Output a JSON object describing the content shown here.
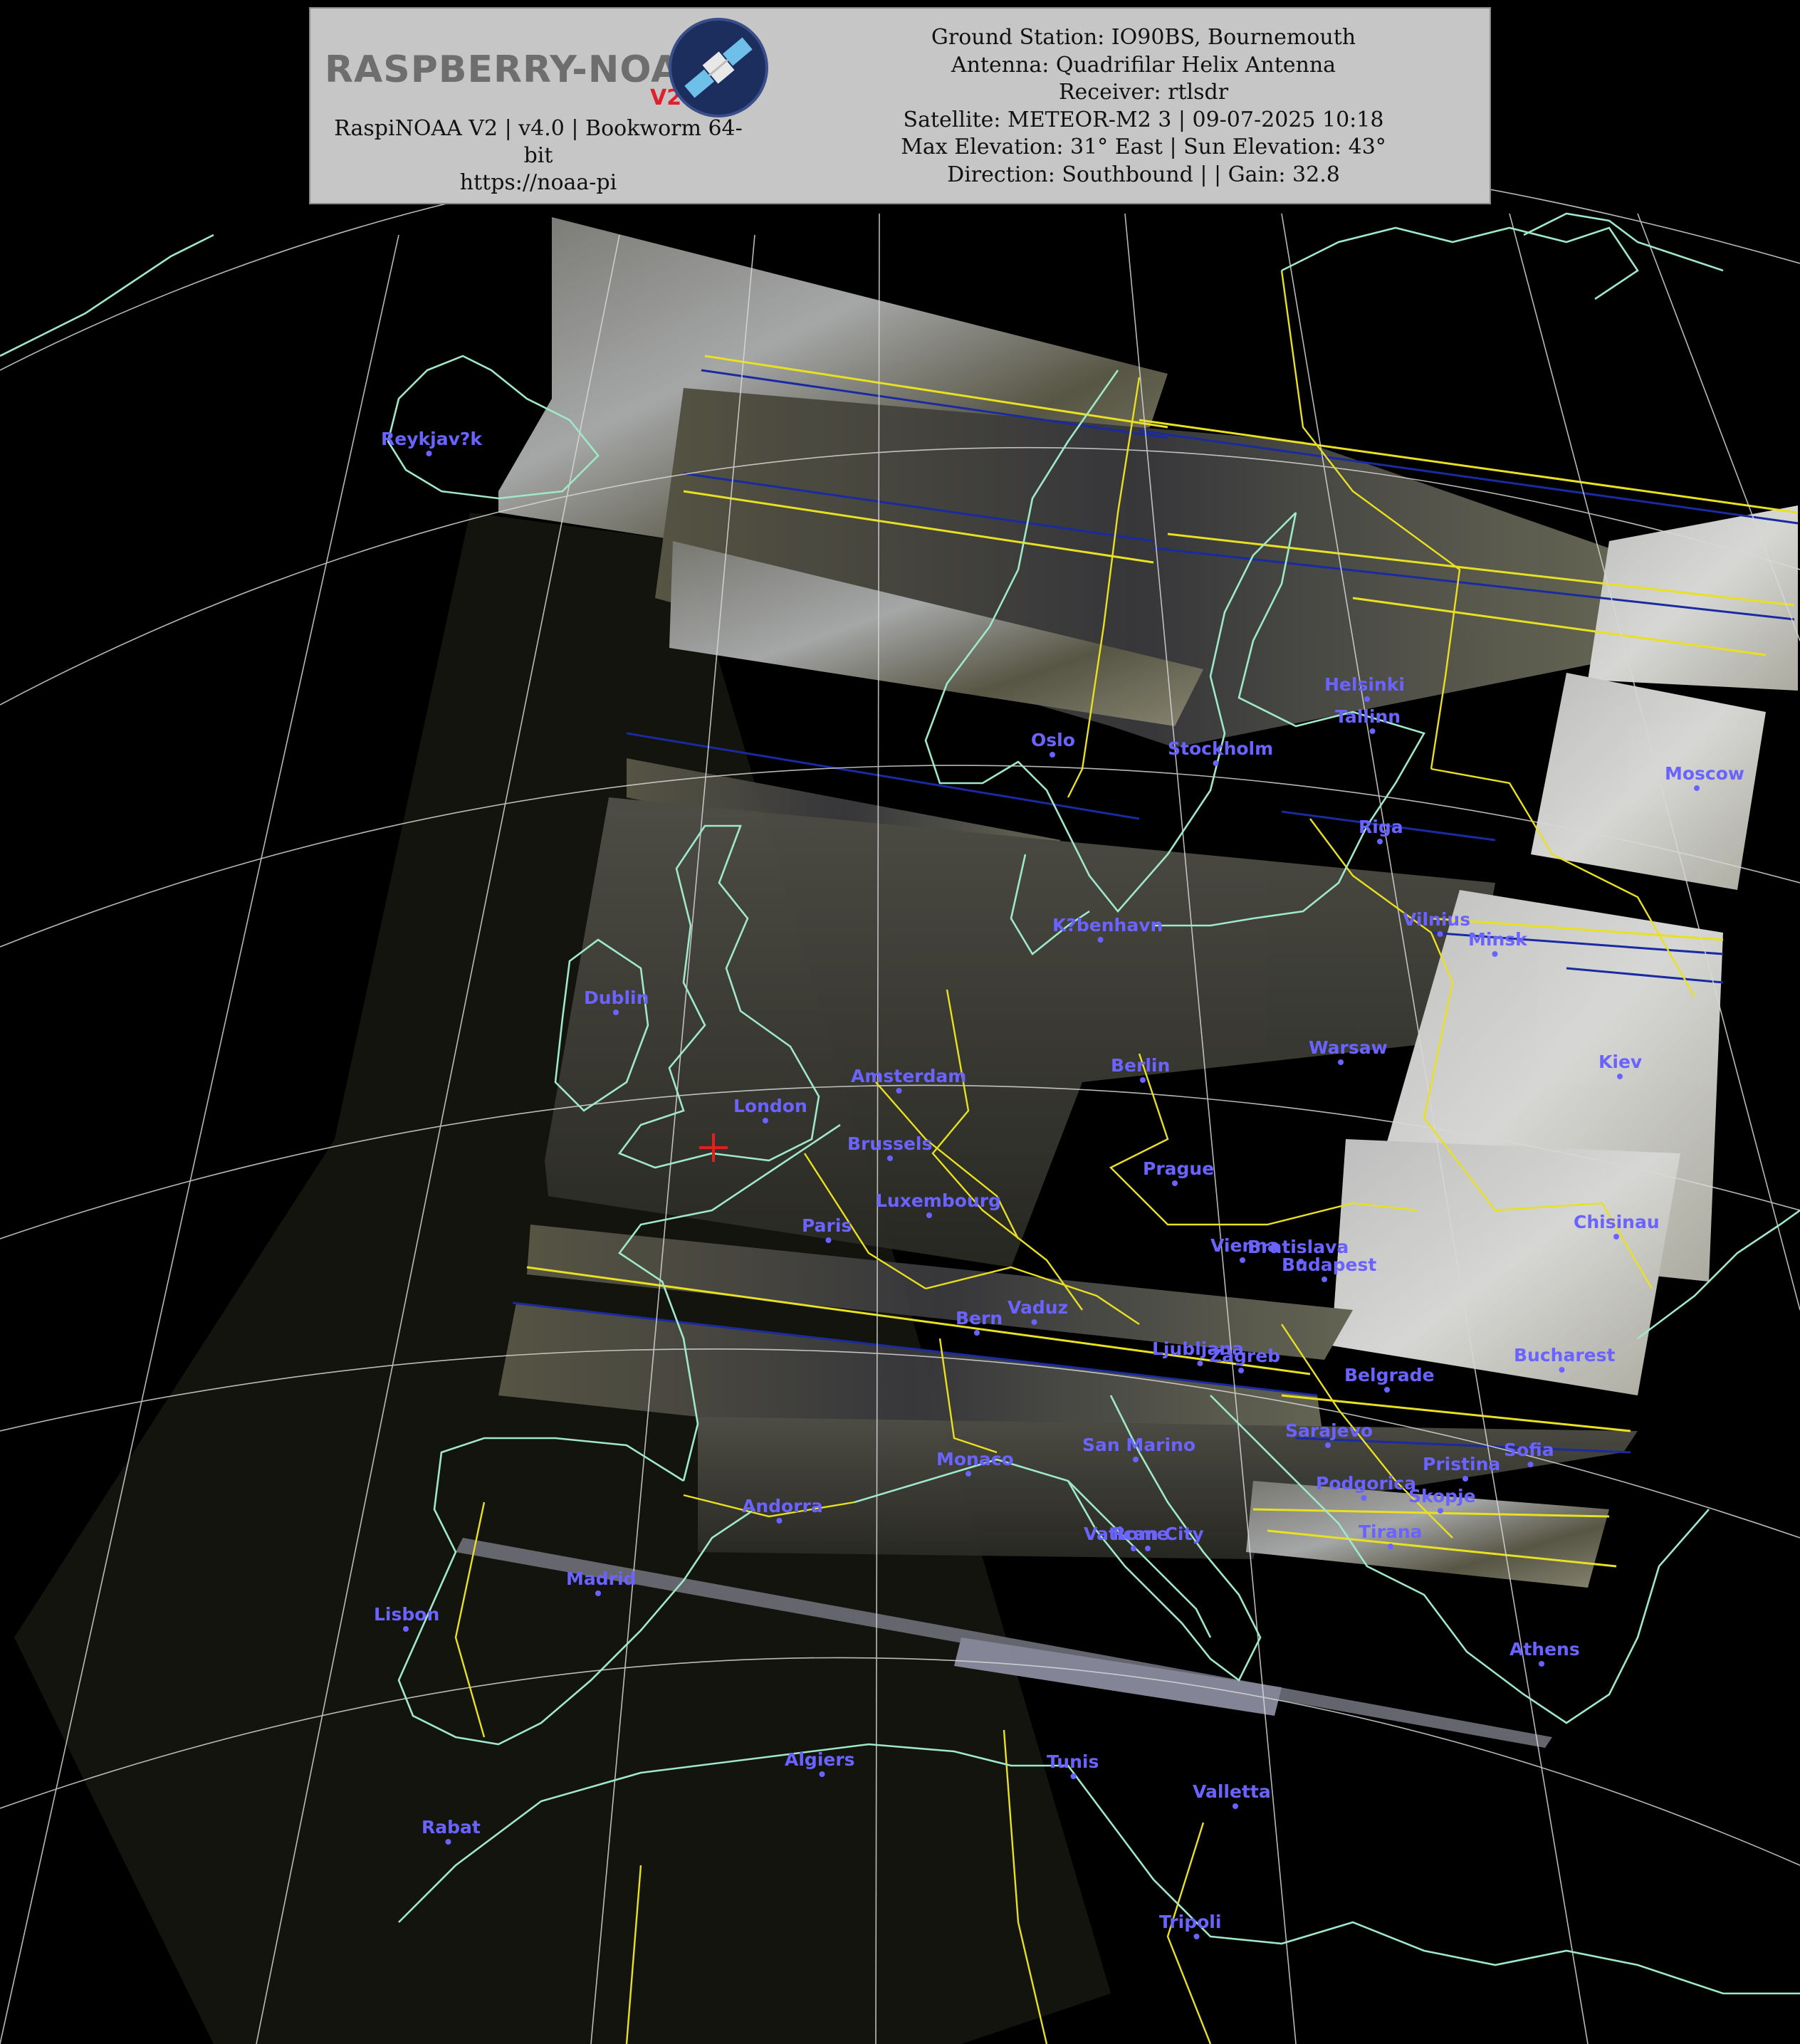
{
  "header": {
    "logo_text": "RASPBERRY-NOAA",
    "logo_badge": "V2",
    "left_lines": [
      "RaspiNOAA V2 | v4.0 | Bookworm 64-",
      "bit",
      "https://noaa-pi"
    ],
    "right_lines": [
      "Ground Station: IO90BS, Bournemouth",
      "Antenna: Quadrifilar Helix Antenna",
      "Receiver: rtlsdr",
      "Satellite: METEOR-M2 3 | 09-07-2025 10:18",
      "Max Elevation: 31° East | Sun Elevation: 43°",
      "Direction: Southbound | | Gain: 32.8"
    ]
  },
  "cities": [
    {
      "name": "Reykjav?k"
    },
    {
      "name": "Oslo"
    },
    {
      "name": "Stockholm"
    },
    {
      "name": "Helsinki"
    },
    {
      "name": "Tallinn"
    },
    {
      "name": "Riga"
    },
    {
      "name": "Moscow"
    },
    {
      "name": "Vilnius"
    },
    {
      "name": "Minsk"
    },
    {
      "name": "K?benhavn"
    },
    {
      "name": "Dublin"
    },
    {
      "name": "Amsterdam"
    },
    {
      "name": "Berlin"
    },
    {
      "name": "Warsaw"
    },
    {
      "name": "Kiev"
    },
    {
      "name": "London"
    },
    {
      "name": "Brussels"
    },
    {
      "name": "Luxembourg"
    },
    {
      "name": "Prague"
    },
    {
      "name": "Paris"
    },
    {
      "name": "Vienna"
    },
    {
      "name": "Bratislava"
    },
    {
      "name": "Budapest"
    },
    {
      "name": "Chisinau"
    },
    {
      "name": "Bern"
    },
    {
      "name": "Vaduz"
    },
    {
      "name": "Ljubljana"
    },
    {
      "name": "Zagreb"
    },
    {
      "name": "Belgrade"
    },
    {
      "name": "Bucharest"
    },
    {
      "name": "Monaco"
    },
    {
      "name": "San Marino"
    },
    {
      "name": "Sarajevo"
    },
    {
      "name": "Sofia"
    },
    {
      "name": "Pristina"
    },
    {
      "name": "Podgorica"
    },
    {
      "name": "Skopje"
    },
    {
      "name": "Andorra"
    },
    {
      "name": "Vatican City"
    },
    {
      "name": "Rome"
    },
    {
      "name": "Tirana"
    },
    {
      "name": "Madrid"
    },
    {
      "name": "Lisbon"
    },
    {
      "name": "Athens"
    },
    {
      "name": "Algiers"
    },
    {
      "name": "Tunis"
    },
    {
      "name": "Valletta"
    },
    {
      "name": "Rabat"
    },
    {
      "name": "Tripoli"
    }
  ],
  "colors": {
    "coastline": "#9fe8c8",
    "borders": "#e8e020",
    "graticule": "#d8d8d8",
    "city_label": "#6b63ff",
    "station_marker": "#e02020",
    "header_bg": "#c6c6c6"
  }
}
